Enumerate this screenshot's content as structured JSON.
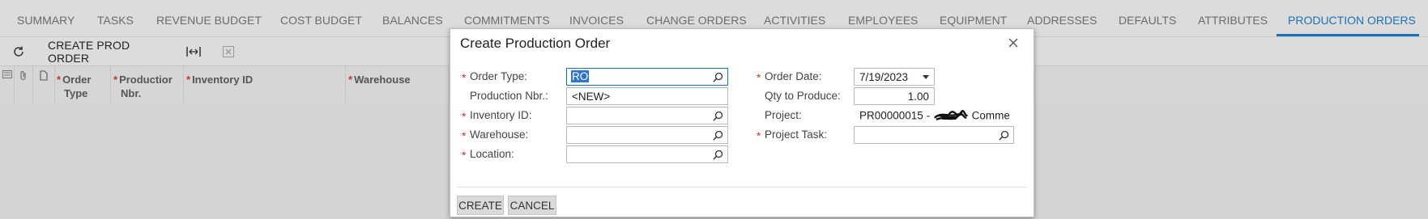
{
  "tabs": [
    {
      "label": "SUMMARY"
    },
    {
      "label": "TASKS"
    },
    {
      "label": "REVENUE BUDGET"
    },
    {
      "label": "COST BUDGET"
    },
    {
      "label": "BALANCES"
    },
    {
      "label": "COMMITMENTS"
    },
    {
      "label": "INVOICES"
    },
    {
      "label": "CHANGE ORDERS"
    },
    {
      "label": "ACTIVITIES"
    },
    {
      "label": "EMPLOYEES"
    },
    {
      "label": "EQUIPMENT"
    },
    {
      "label": "ADDRESSES"
    },
    {
      "label": "DEFAULTS"
    },
    {
      "label": "ATTRIBUTES"
    },
    {
      "label": "PRODUCTION ORDERS"
    }
  ],
  "active_tab": "PRODUCTION ORDERS",
  "toolbar": {
    "create_prod_order_label": "CREATE PROD ORDER",
    "icons": [
      "refresh-icon",
      "fit-columns-icon",
      "export-excel-icon"
    ]
  },
  "grid": {
    "columns": [
      {
        "label": "Order Type",
        "line1": "Order",
        "line2": "Type",
        "required": true
      },
      {
        "label": "Production Nbr.",
        "line1": "Productior",
        "line2": "Nbr.",
        "required": true
      },
      {
        "label": "Inventory ID",
        "line1": "Inventory ID",
        "line2": "",
        "required": true
      },
      {
        "label": "Warehouse",
        "line1": "Warehouse",
        "line2": "",
        "required": true
      }
    ],
    "required_marker": "*"
  },
  "dialog": {
    "title": "Create Production Order",
    "left_fields": [
      {
        "label": "Order Type:",
        "value": "RO",
        "required": true,
        "lookup": true
      },
      {
        "label": "Production Nbr.:",
        "value": "<NEW>",
        "required": false,
        "lookup": false
      },
      {
        "label": "Inventory ID:",
        "value": "",
        "required": true,
        "lookup": true
      },
      {
        "label": "Warehouse:",
        "value": "",
        "required": true,
        "lookup": true
      },
      {
        "label": "Location:",
        "value": "",
        "required": true,
        "lookup": true
      }
    ],
    "right_fields": [
      {
        "label": "Order Date:",
        "value": "7/19/2023",
        "required": true
      },
      {
        "label": "Qty to Produce:",
        "value": "1.00",
        "required": false
      },
      {
        "label": "Project:",
        "value_prefix": "PR00000015 -",
        "value_suffix": "Commerc",
        "required": false
      },
      {
        "label": "Project Task:",
        "value": "",
        "required": true
      }
    ],
    "buttons": {
      "create": "CREATE",
      "cancel": "CANCEL"
    }
  },
  "colors": {
    "accent": "#1a72b8",
    "required": "#c0392b",
    "selection": "#2f76c8"
  }
}
